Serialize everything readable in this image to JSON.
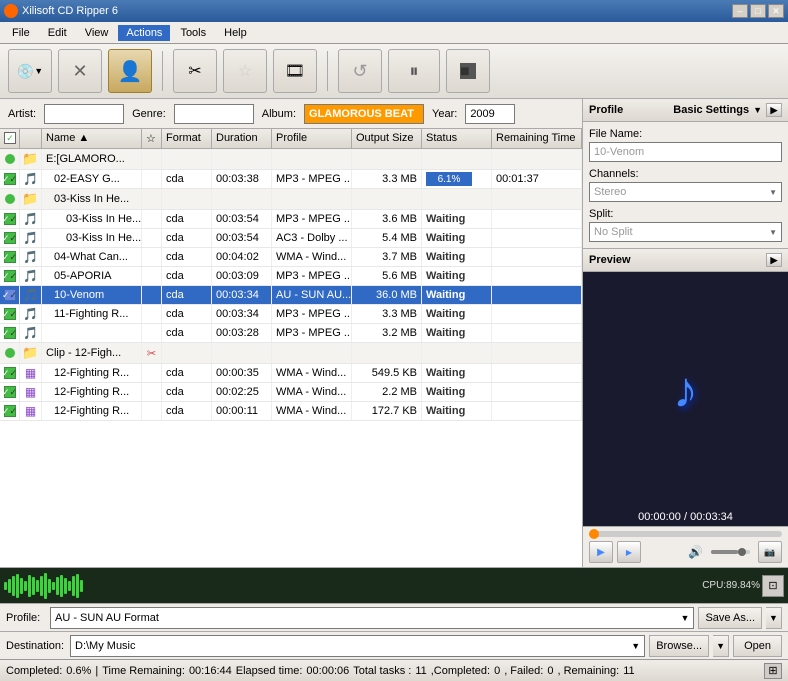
{
  "app": {
    "title": "Xilisoft CD Ripper 6",
    "icon": "cd-icon"
  },
  "titlebar": {
    "minimize_label": "–",
    "maximize_label": "□",
    "close_label": "✕"
  },
  "menu": {
    "items": [
      {
        "label": "File",
        "id": "file"
      },
      {
        "label": "Edit",
        "id": "edit"
      },
      {
        "label": "View",
        "id": "view"
      },
      {
        "label": "Actions",
        "id": "actions"
      },
      {
        "label": "Tools",
        "id": "tools"
      },
      {
        "label": "Help",
        "id": "help"
      }
    ]
  },
  "toolbar": {
    "buttons": [
      {
        "id": "add-cd",
        "icon": "💿",
        "label": "Add CD"
      },
      {
        "id": "remove",
        "icon": "✕",
        "label": "Remove"
      },
      {
        "id": "rip",
        "icon": "👤",
        "label": "Rip"
      },
      {
        "id": "cut",
        "icon": "✂",
        "label": "Cut"
      },
      {
        "id": "star",
        "icon": "☆",
        "label": "Star"
      },
      {
        "id": "film",
        "icon": "🎬",
        "label": "Film"
      },
      {
        "id": "refresh",
        "icon": "↺",
        "label": "Refresh"
      },
      {
        "id": "pause",
        "icon": "⏸",
        "label": "Pause"
      },
      {
        "id": "stop",
        "icon": "■",
        "label": "Stop"
      }
    ]
  },
  "fields": {
    "artist_label": "Artist:",
    "artist_value": "",
    "genre_label": "Genre:",
    "genre_value": "",
    "album_label": "Album:",
    "album_value": "GLAMOROUS BEAT",
    "year_label": "Year:",
    "year_value": "2009"
  },
  "table": {
    "headers": [
      "",
      "",
      "Name",
      "",
      "Format",
      "Duration",
      "Profile",
      "Output Size",
      "Status",
      "Remaining Time"
    ],
    "rows": [
      {
        "indent": 0,
        "type": "folder",
        "check": "circle-green",
        "icon": "folder",
        "name": "E:[GLAMORO...",
        "star": "",
        "format": "",
        "duration": "",
        "profile": "",
        "size": "",
        "status": "",
        "remaining": ""
      },
      {
        "indent": 1,
        "type": "file",
        "check": "checked",
        "icon": "music",
        "name": "02-EASY G...",
        "star": "",
        "format": "cda",
        "duration": "00:03:38",
        "profile": "MP3 - MPEG ...",
        "size": "3.3 MB",
        "status": "progress",
        "progress": "6.1%",
        "remaining": "00:01:37"
      },
      {
        "indent": 1,
        "type": "folder",
        "check": "circle-green",
        "icon": "folder",
        "name": "03-Kiss In He...",
        "star": "",
        "format": "",
        "duration": "",
        "profile": "",
        "size": "",
        "status": "",
        "remaining": ""
      },
      {
        "indent": 2,
        "type": "file",
        "check": "checked",
        "icon": "music",
        "name": "03-Kiss In He...",
        "star": "",
        "format": "cda",
        "duration": "00:03:54",
        "profile": "MP3 - MPEG ...",
        "size": "3.6 MB",
        "status": "Waiting",
        "remaining": ""
      },
      {
        "indent": 2,
        "type": "file",
        "check": "checked",
        "icon": "music",
        "name": "03-Kiss In He...",
        "star": "",
        "format": "cda",
        "duration": "00:03:54",
        "profile": "AC3 - Dolby ...",
        "size": "5.4 MB",
        "status": "Waiting",
        "remaining": ""
      },
      {
        "indent": 1,
        "type": "file",
        "check": "checked",
        "icon": "music",
        "name": "04-What Can...",
        "star": "",
        "format": "cda",
        "duration": "00:04:02",
        "profile": "WMA - Wind...",
        "size": "3.7 MB",
        "status": "Waiting",
        "remaining": ""
      },
      {
        "indent": 1,
        "type": "file",
        "check": "checked",
        "icon": "music",
        "name": "05-APORIA",
        "star": "",
        "format": "cda",
        "duration": "00:03:09",
        "profile": "MP3 - MPEG ...",
        "size": "5.6 MB",
        "status": "Waiting",
        "remaining": ""
      },
      {
        "indent": 1,
        "type": "file",
        "check": "checked",
        "icon": "music",
        "name": "10-Venom",
        "star": "",
        "format": "cda",
        "duration": "00:03:34",
        "profile": "AU - SUN AU...",
        "size": "36.0 MB",
        "status": "Waiting",
        "remaining": "",
        "selected": true
      },
      {
        "indent": 1,
        "type": "file",
        "check": "checked",
        "icon": "music",
        "name": "11-Fighting R...",
        "star": "",
        "format": "cda",
        "duration": "00:03:34",
        "profile": "MP3 - MPEG ...",
        "size": "3.3 MB",
        "status": "Waiting",
        "remaining": ""
      },
      {
        "indent": 1,
        "type": "file",
        "check": "checked",
        "icon": "music",
        "name": "",
        "star": "",
        "format": "cda",
        "duration": "00:03:28",
        "profile": "MP3 - MPEG ...",
        "size": "3.2 MB",
        "status": "Waiting",
        "remaining": ""
      },
      {
        "indent": 0,
        "type": "folder",
        "check": "circle-green",
        "icon": "folder",
        "name": "Clip - 12-Figh...",
        "star": "",
        "format": "",
        "duration": "",
        "profile": "",
        "size": "",
        "status": "",
        "remaining": ""
      },
      {
        "indent": 1,
        "type": "file",
        "check": "checked",
        "icon": "wma",
        "name": "12-Fighting R...",
        "star": "",
        "format": "cda",
        "duration": "00:00:35",
        "profile": "WMA - Wind...",
        "size": "549.5 KB",
        "status": "Waiting",
        "remaining": ""
      },
      {
        "indent": 1,
        "type": "file",
        "check": "checked",
        "icon": "wma",
        "name": "12-Fighting R...",
        "star": "",
        "format": "cda",
        "duration": "00:02:25",
        "profile": "WMA - Wind...",
        "size": "2.2 MB",
        "status": "Waiting",
        "remaining": ""
      },
      {
        "indent": 1,
        "type": "file",
        "check": "checked",
        "icon": "wma",
        "name": "12-Fighting R...",
        "star": "",
        "format": "cda",
        "duration": "00:00:11",
        "profile": "WMA - Wind...",
        "size": "172.7 KB",
        "status": "Waiting",
        "remaining": ""
      }
    ]
  },
  "right_panel": {
    "profile_section": {
      "title": "Profile",
      "settings_label": "Basic Settings",
      "arrow": "▶",
      "file_name_label": "File Name:",
      "file_name_value": "10-Venom",
      "channels_label": "Channels:",
      "channels_value": "Stereo",
      "split_label": "Split:",
      "split_value": "No Split"
    },
    "preview_section": {
      "title": "Preview",
      "time_display": "00:00:00 / 00:03:34",
      "play_btn": "▶",
      "rewind_btn": "◀◀",
      "stop_btn": "■",
      "volume_label": "Volume",
      "screenshot_btn": "📷"
    }
  },
  "bottom": {
    "cpu_label": "CPU:89.84%",
    "profile_label": "Profile:",
    "profile_value": "AU - SUN AU Format",
    "save_as_label": "Save As...",
    "destination_label": "Destination:",
    "destination_value": "D:\\My Music",
    "browse_label": "Browse...",
    "open_label": "Open"
  },
  "status_bar": {
    "completed_label": "Completed:",
    "completed_value": "0.6%",
    "time_remaining_label": "Time Remaining:",
    "time_remaining_value": "00:16:44",
    "elapsed_label": "Elapsed time:",
    "elapsed_value": "00:00:06",
    "total_tasks_label": "Total tasks:",
    "total_tasks_value": "11",
    "completed_tasks_label": "Completed:",
    "completed_tasks_value": "0",
    "failed_label": "Failed:",
    "failed_value": "0",
    "remaining_tasks_label": "Remaining:",
    "remaining_tasks_value": "11"
  }
}
